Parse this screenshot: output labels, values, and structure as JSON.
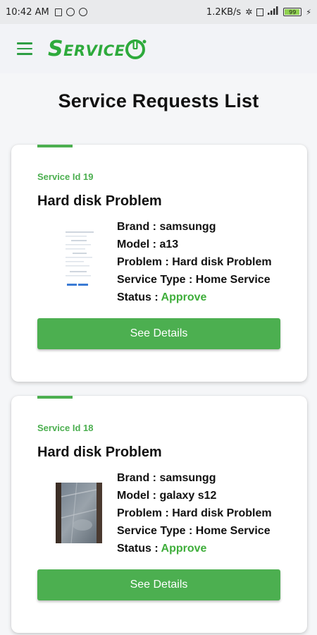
{
  "status_bar": {
    "time": "10:42 AM",
    "speed": "1.2KB/s",
    "battery": "99"
  },
  "app_bar": {
    "logo_text": "Service"
  },
  "page": {
    "title": "Service Requests List"
  },
  "requests": [
    {
      "service_id": "Service Id 19",
      "title": "Hard disk Problem",
      "brand_label": "Brand :",
      "brand": "samsungg",
      "model_label": "Model :",
      "model": "a13",
      "problem_label": "Problem :",
      "problem": "Hard disk Problem",
      "service_type_label": "Service Type :",
      "service_type": "Home Service",
      "status_label": "Status :",
      "status": "Approve",
      "button_label": "See Details",
      "thumbnail": "screenshot-thumbnail"
    },
    {
      "service_id": "Service Id 18",
      "title": "Hard disk Problem",
      "brand_label": "Brand :",
      "brand": "samsungg",
      "model_label": "Model :",
      "model": "galaxy s12",
      "problem_label": "Problem :",
      "problem": "Hard disk Problem",
      "service_type_label": "Service Type :",
      "service_type": "Home Service",
      "status_label": "Status :",
      "status": "Approve",
      "button_label": "See Details",
      "thumbnail": "photo-thumbnail"
    }
  ],
  "colors": {
    "accent": "#4caf50",
    "status_approve": "#3fae3b",
    "logo": "#2eaa3c"
  }
}
